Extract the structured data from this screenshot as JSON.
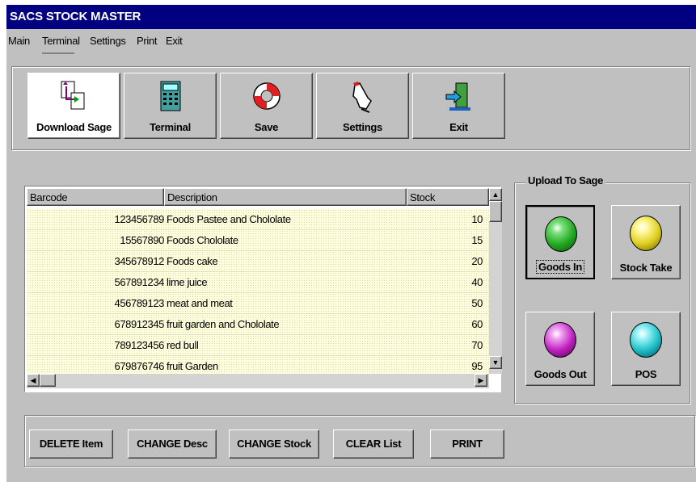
{
  "window": {
    "title": "SACS STOCK MASTER"
  },
  "menu": [
    "Main",
    "Terminal",
    "Settings",
    "Print",
    "Exit"
  ],
  "toolbar": {
    "download": "Download Sage",
    "terminal": "Terminal",
    "save": "Save",
    "settings": "Settings",
    "exit": "Exit"
  },
  "grid": {
    "columns": [
      "Barcode",
      "Description",
      "Stock"
    ],
    "rows": [
      {
        "barcode": "123456789",
        "description": "Foods Pastee and Chololate",
        "stock": "10"
      },
      {
        "barcode": "15567890",
        "description": "Foods Chololate",
        "stock": "15"
      },
      {
        "barcode": "345678912",
        "description": "Foods cake",
        "stock": "20"
      },
      {
        "barcode": "567891234",
        "description": "lime juice",
        "stock": "40"
      },
      {
        "barcode": "456789123",
        "description": "meat and meat",
        "stock": "50"
      },
      {
        "barcode": "678912345",
        "description": "fruit garden and Chololate",
        "stock": "60"
      },
      {
        "barcode": "789123456",
        "description": "red bull",
        "stock": "70"
      },
      {
        "barcode": "679876746",
        "description": "fruit Garden",
        "stock": "95"
      }
    ]
  },
  "upload": {
    "title": "Upload To Sage",
    "goods_in": "Goods In",
    "stock_take": "Stock Take",
    "goods_out": "Goods Out",
    "pos": "POS",
    "colors": {
      "goods_in": "#22aa22",
      "stock_take": "#e0d020",
      "goods_out": "#c020c0",
      "pos": "#20c0c8"
    }
  },
  "actions": {
    "delete": "DELETE Item",
    "change_desc": "CHANGE Desc",
    "change_stock": "CHANGE Stock",
    "clear": "CLEAR List",
    "print": "PRINT"
  }
}
